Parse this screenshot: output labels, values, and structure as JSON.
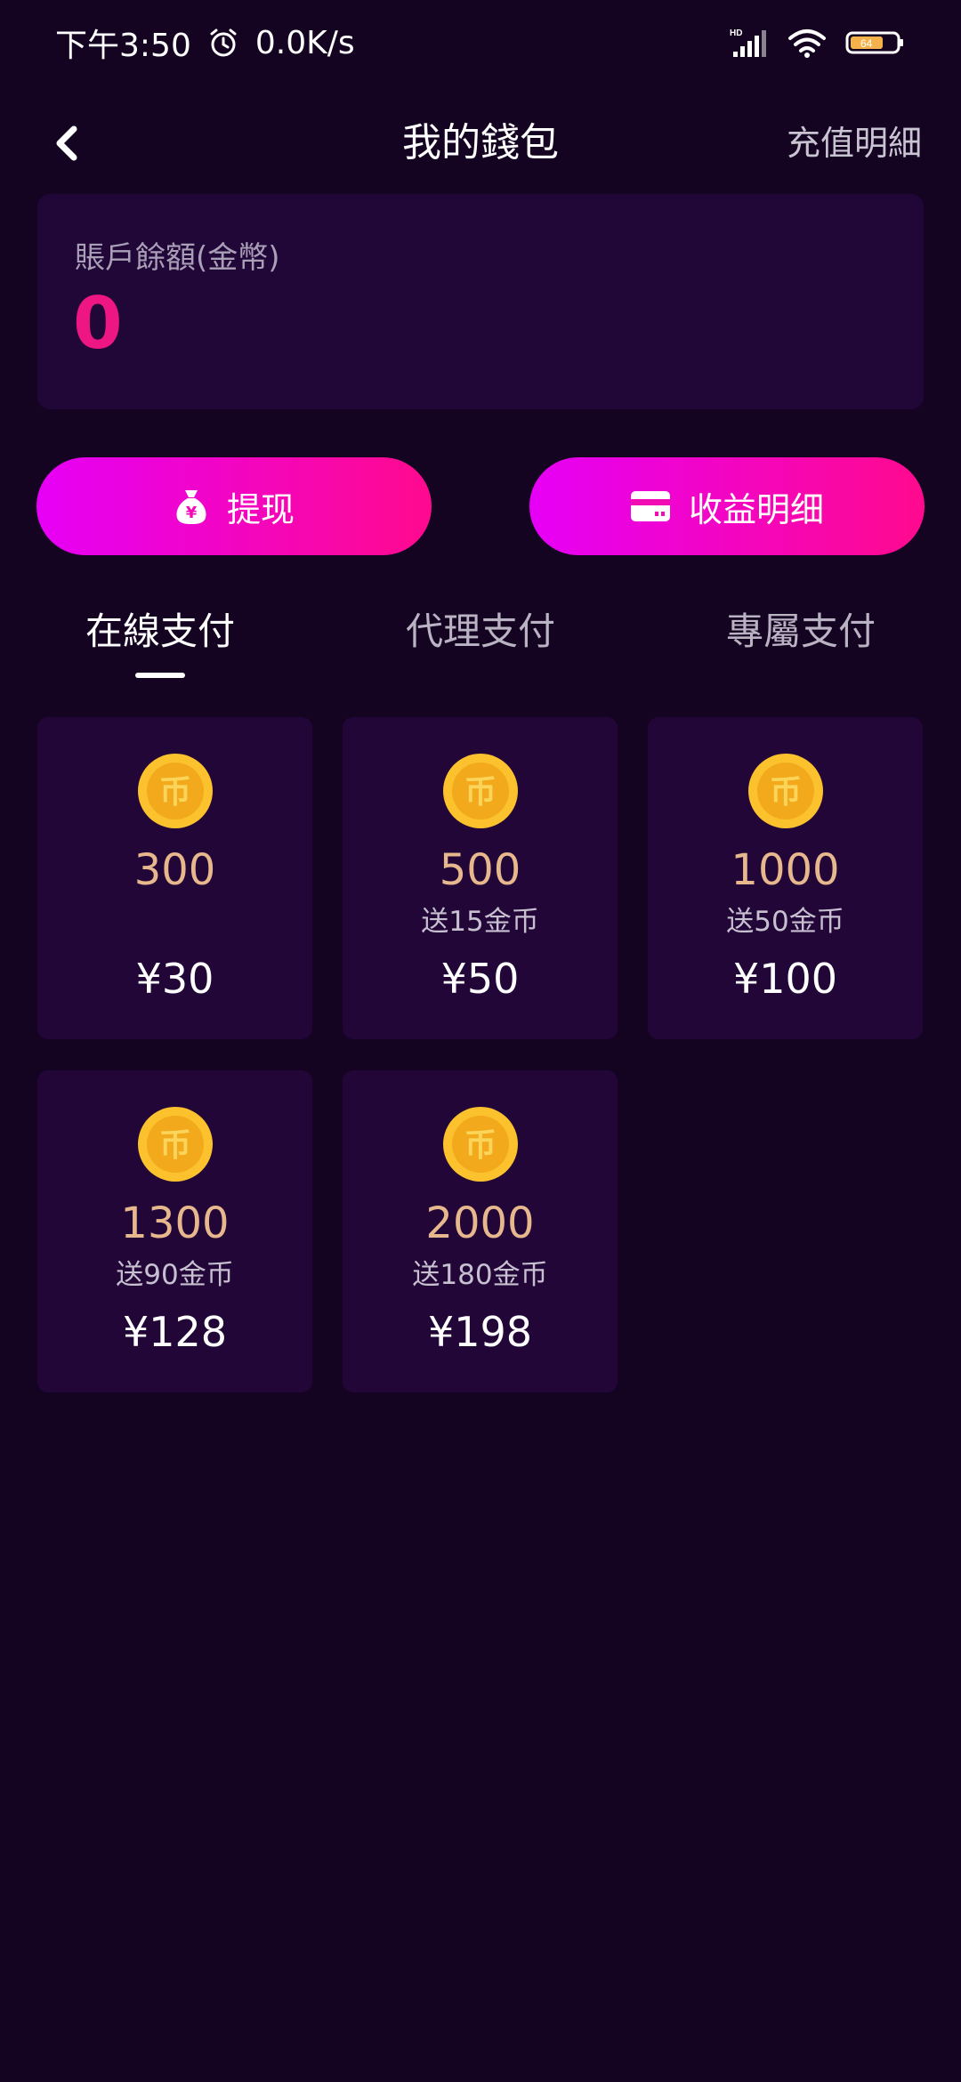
{
  "status_bar": {
    "time": "下午3:50",
    "net_speed": "0.0K/s",
    "alarm_icon": "alarm-clock-icon",
    "signal_icon": "hd-signal-icon",
    "wifi_icon": "wifi-icon",
    "battery_icon": "battery-icon",
    "battery_level": "64"
  },
  "header": {
    "back_icon": "chevron-left-icon",
    "title": "我的錢包",
    "right_link": "充值明細"
  },
  "balance": {
    "label": "賬戶餘額(金幣)",
    "value": "0"
  },
  "actions": {
    "withdraw_label": "提现",
    "withdraw_icon": "money-bag-icon",
    "earnings_label": "收益明细",
    "earnings_icon": "card-icon"
  },
  "tabs": [
    {
      "label": "在線支付",
      "active": true
    },
    {
      "label": "代理支付",
      "active": false
    },
    {
      "label": "專屬支付",
      "active": false
    }
  ],
  "packages": [
    {
      "coins": "300",
      "bonus": "",
      "price": "¥30"
    },
    {
      "coins": "500",
      "bonus": "送15金币",
      "price": "¥50"
    },
    {
      "coins": "1000",
      "bonus": "送50金币",
      "price": "¥100"
    },
    {
      "coins": "1300",
      "bonus": "送90金币",
      "price": "¥128"
    },
    {
      "coins": "2000",
      "bonus": "送180金币",
      "price": "¥198"
    }
  ],
  "colors": {
    "background": "#150322",
    "card": "#220637",
    "accent_pink": "#ee1682",
    "gradient_start": "#e600f6",
    "gradient_end": "#ff0a8e",
    "coin_amount": "#e7b88d",
    "coin_gold": "#fbc22e"
  }
}
